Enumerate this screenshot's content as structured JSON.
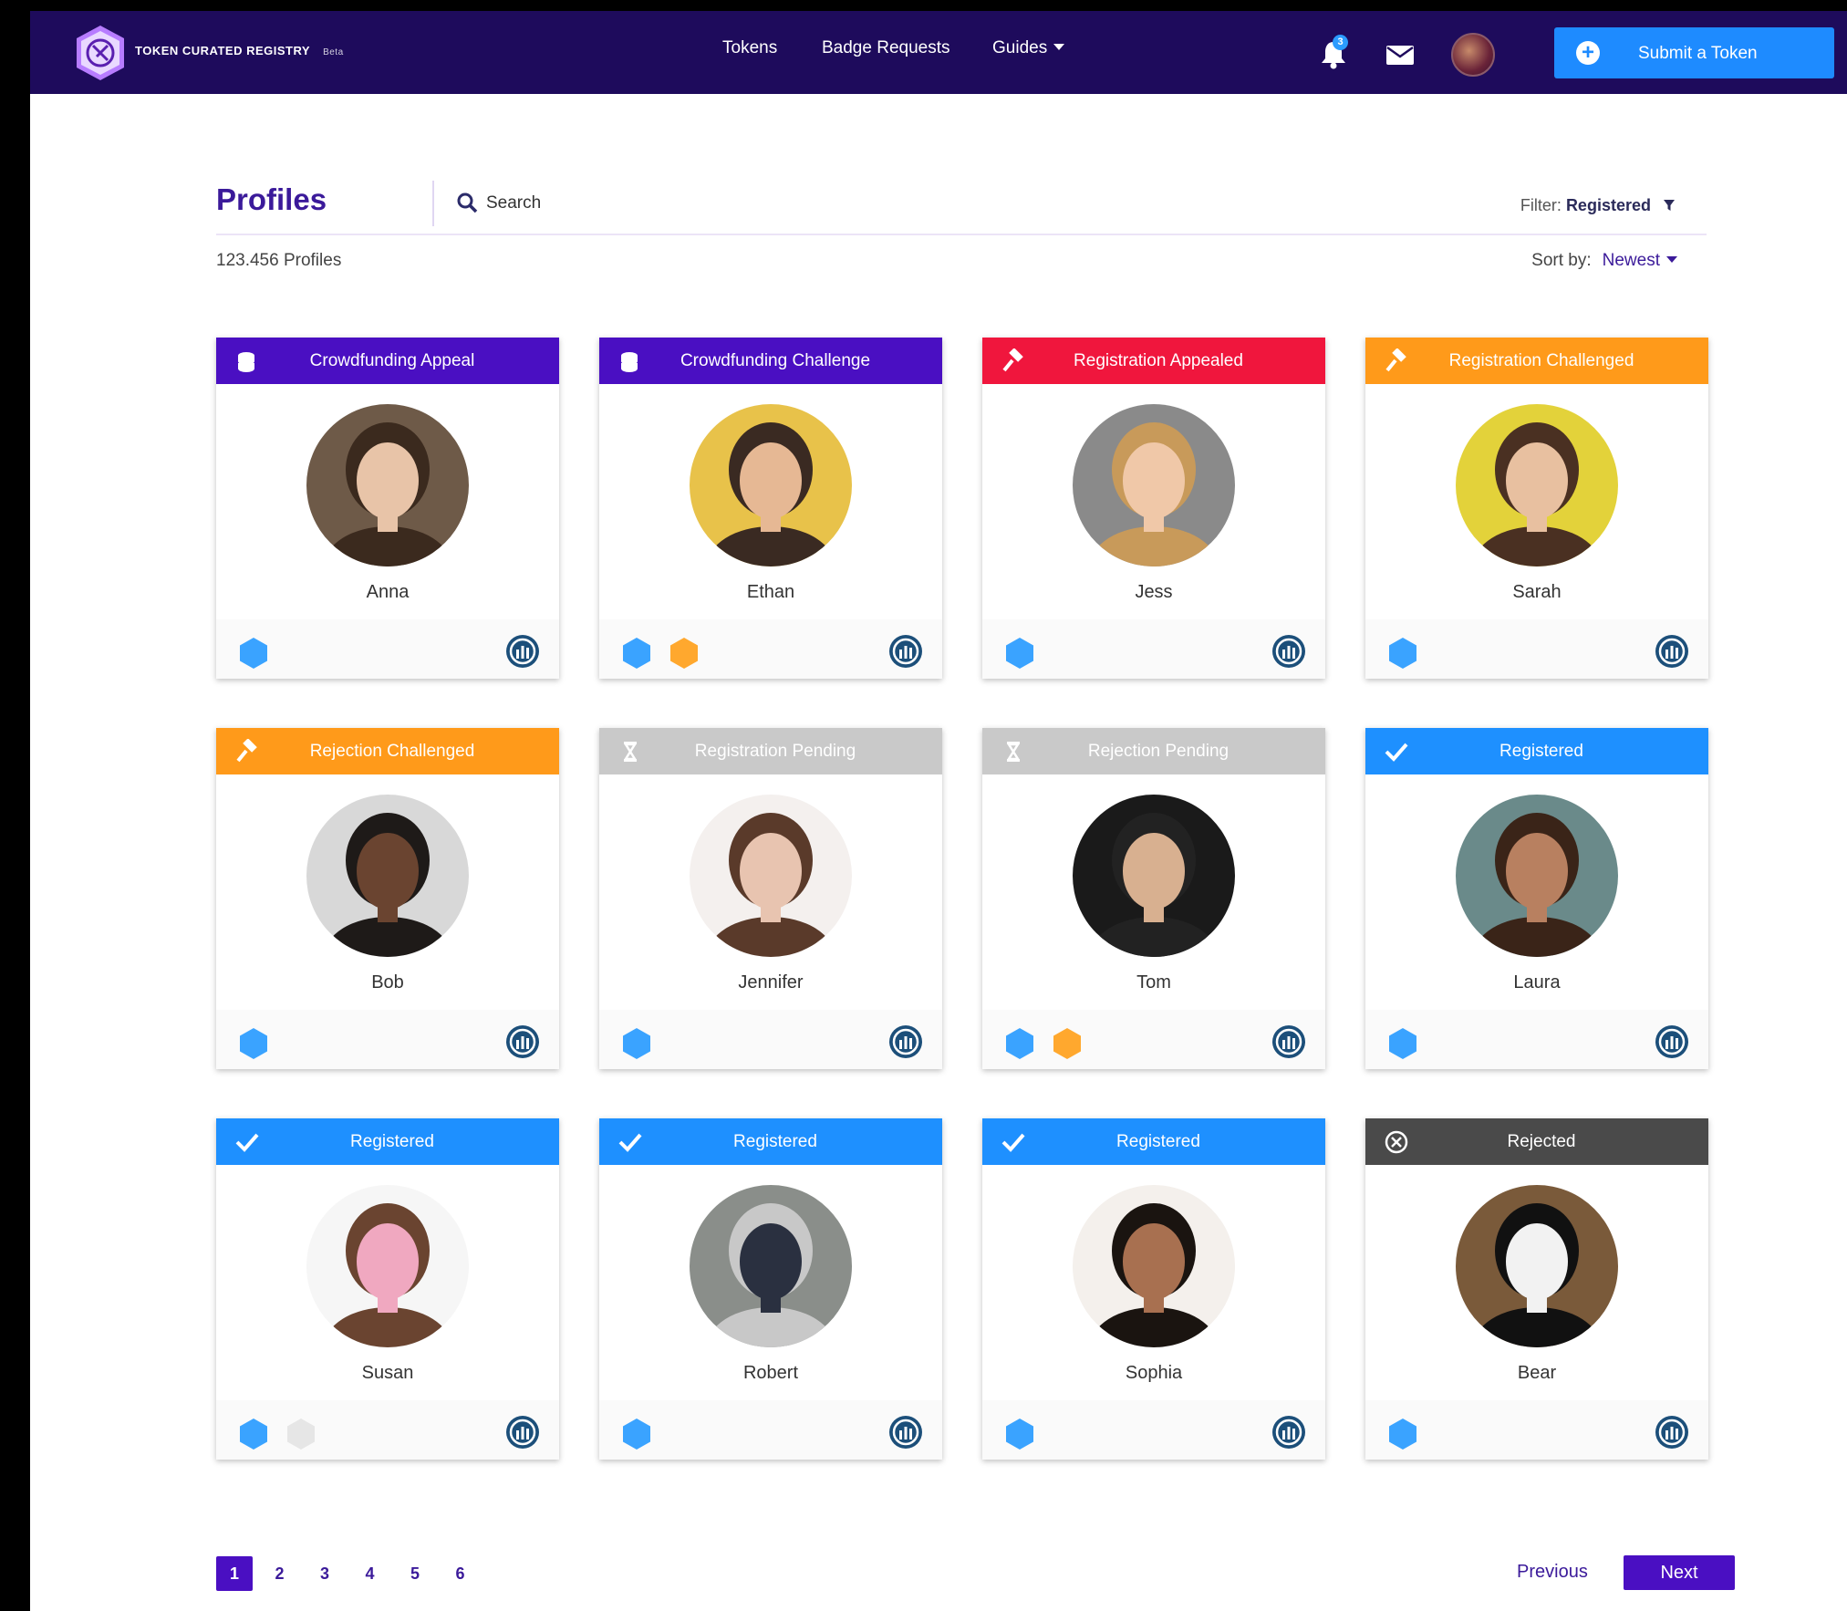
{
  "app": {
    "logo_text": "TOKEN CURATED REGISTRY",
    "beta": "Beta",
    "nav": {
      "tokens": "Tokens",
      "badge_requests": "Badge Requests",
      "guides": "Guides"
    },
    "notification_count": "3",
    "submit_label": "Submit a Token"
  },
  "toolbar": {
    "title": "Profiles",
    "search_placeholder": "Search",
    "filter_label": "Filter:",
    "filter_value": "Registered",
    "count": "123.456 Profiles",
    "sort_label": "Sort by:",
    "sort_value": "Newest"
  },
  "colors": {
    "topbar": "#1e0b5c",
    "accent": "#4a0fc2",
    "appealed": "#f0163d",
    "challenged": "#ff9a1a",
    "pending": "#c9c9c9",
    "registered": "#1e90ff",
    "rejected": "#4a4a4a",
    "badge_blue": "#3aa3ff",
    "badge_orange": "#ffa82e"
  },
  "cards": [
    {
      "status": "Crowdfunding Appeal",
      "status_icon": "coins-icon",
      "name": "Anna",
      "badges": [
        "blue"
      ],
      "photo": [
        "#6e5a48",
        "#3b2a1e",
        "#e8c4a8"
      ]
    },
    {
      "status": "Crowdfunding Challenge",
      "status_icon": "coins-icon",
      "name": "Ethan",
      "badges": [
        "blue",
        "orange"
      ],
      "photo": [
        "#e8c24a",
        "#3a2a22",
        "#e6b894"
      ]
    },
    {
      "status": "Registration Appealed",
      "status_icon": "gavel-icon",
      "name": "Jess",
      "badges": [
        "blue"
      ],
      "photo": [
        "#8a8a8a",
        "#c89a5a",
        "#f0c8a8"
      ]
    },
    {
      "status": "Registration Challenged",
      "status_icon": "gavel-icon",
      "name": "Sarah",
      "badges": [
        "blue"
      ],
      "photo": [
        "#e3d23a",
        "#4a3022",
        "#e8c0a0"
      ]
    },
    {
      "status": "Rejection Challenged",
      "status_icon": "gavel-icon",
      "name": "Bob",
      "badges": [
        "blue"
      ],
      "photo": [
        "#d8d8d8",
        "#1e1a18",
        "#6a4430"
      ]
    },
    {
      "status": "Registration Pending",
      "status_icon": "hourglass-icon",
      "name": "Jennifer",
      "badges": [
        "blue"
      ],
      "photo": [
        "#f4f0ee",
        "#5a3a2a",
        "#e8c4b0"
      ]
    },
    {
      "status": "Rejection Pending",
      "status_icon": "hourglass-icon",
      "name": "Tom",
      "badges": [
        "blue",
        "orange"
      ],
      "photo": [
        "#1a1a1a",
        "#222222",
        "#d8b090"
      ]
    },
    {
      "status": "Registered",
      "status_icon": "check-icon",
      "name": "Laura",
      "badges": [
        "blue"
      ],
      "photo": [
        "#6a8a8a",
        "#3a2418",
        "#b88060"
      ]
    },
    {
      "status": "Registered",
      "status_icon": "check-icon",
      "name": "Susan",
      "badges": [
        "blue",
        "gray"
      ],
      "photo": [
        "#f6f6f6",
        "#6a4430",
        "#f0a8c0"
      ]
    },
    {
      "status": "Registered",
      "status_icon": "check-icon",
      "name": "Robert",
      "badges": [
        "blue"
      ],
      "photo": [
        "#8a8e8a",
        "#c8c8c8",
        "#2a3040"
      ]
    },
    {
      "status": "Registered",
      "status_icon": "check-icon",
      "name": "Sophia",
      "badges": [
        "blue"
      ],
      "photo": [
        "#f4f0ec",
        "#1a1410",
        "#a87050"
      ]
    },
    {
      "status": "Rejected",
      "status_icon": "x-circle-icon",
      "name": "Bear",
      "badges": [
        "blue"
      ],
      "photo": [
        "#7a5a3a",
        "#111111",
        "#f2f2f2"
      ]
    }
  ],
  "pagination": {
    "pages": [
      "1",
      "2",
      "3",
      "4",
      "5",
      "6"
    ],
    "active": "1",
    "previous": "Previous",
    "next": "Next"
  }
}
